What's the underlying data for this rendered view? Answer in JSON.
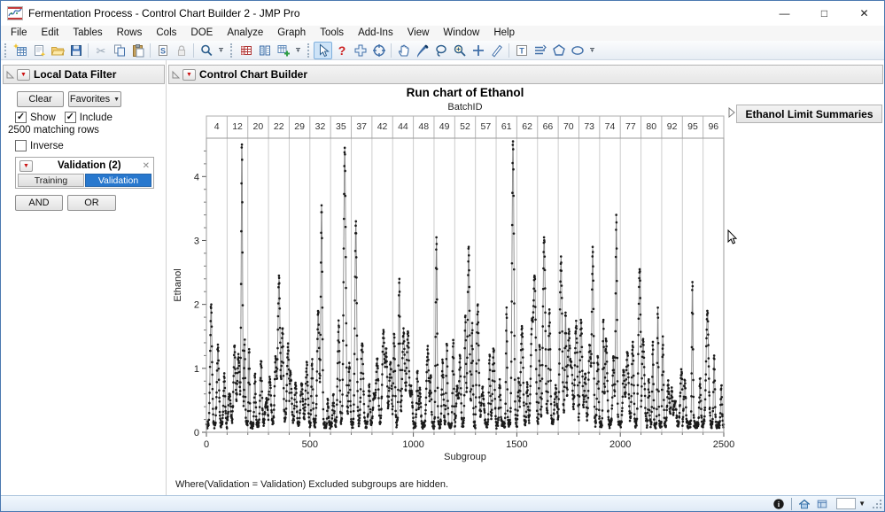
{
  "window": {
    "title": "Fermentation Process - Control Chart Builder 2 - JMP Pro",
    "controls": {
      "minimize": "—",
      "maximize": "□",
      "close": "✕"
    }
  },
  "menu": {
    "items": [
      "File",
      "Edit",
      "Tables",
      "Rows",
      "Cols",
      "DOE",
      "Analyze",
      "Graph",
      "Tools",
      "Add-Ins",
      "View",
      "Window",
      "Help"
    ]
  },
  "toolbar": {
    "selected_tool": "arrow-tool",
    "groups": [
      {
        "icons": [
          "new-data-table",
          "new-window",
          "open-file",
          "save",
          "sep",
          "cut",
          "copy",
          "paste",
          "sep",
          "journal",
          "lock",
          "sep",
          "search"
        ],
        "overflow": true
      },
      {
        "icons": [
          "data-table",
          "columns-viewer",
          "table-add"
        ],
        "overflow": true
      },
      {
        "icons": [
          "arrow-tool",
          "help-tool",
          "move-tool",
          "target-tool",
          "sep",
          "grabber-tool",
          "brush-tool",
          "lasso-tool",
          "magnifier-tool",
          "crosshair-tool",
          "eraser-tool",
          "sep",
          "annotate-tool",
          "line-tool",
          "polygon-tool",
          "oval-tool"
        ],
        "overflow": true
      }
    ]
  },
  "ui": {
    "red_triangle": "▼",
    "caret_down": "▼",
    "close_glyph": "✕"
  },
  "data_filter": {
    "title": "Local Data Filter",
    "clear_label": "Clear",
    "favorites_label": "Favorites",
    "show_label": "Show",
    "include_label": "Include",
    "show_check": "✓",
    "include_check": "✓",
    "inverse_check": "",
    "matching_rows": "2500 matching rows",
    "inverse_label": "Inverse",
    "filter": {
      "title": "Validation (2)",
      "options": [
        {
          "label": "Training",
          "selected": false
        },
        {
          "label": "Validation",
          "selected": true
        }
      ]
    },
    "and_label": "AND",
    "or_label": "OR"
  },
  "report": {
    "title": "Control Chart Builder",
    "limit_summaries_title": "Ethanol Limit Summaries",
    "footnote": "Where(Validation = Validation) Excluded subgroups are hidden."
  },
  "chart_data": {
    "type": "line",
    "title": "Run chart of Ethanol",
    "top_axis_label": "BatchID",
    "xlabel": "Subgroup",
    "ylabel": "Ethanol",
    "xlim": [
      0,
      2500
    ],
    "ylim": [
      0,
      4.6
    ],
    "x_major_ticks": [
      0,
      500,
      1000,
      1500,
      2000,
      2500
    ],
    "x_minor_step": 100,
    "y_major_ticks": [
      0,
      1,
      2,
      3,
      4
    ],
    "y_minor_step": 0.2,
    "points_per_batch": 100,
    "marker_color": "#1a1a1a",
    "line_color": "#878787",
    "boundary_line_color": "#cccccc",
    "batches": [
      {
        "id": "4",
        "peak": 2.0
      },
      {
        "id": "12",
        "peak": 4.5
      },
      {
        "id": "20",
        "peak": 1.3
      },
      {
        "id": "22",
        "peak": 2.45
      },
      {
        "id": "29",
        "peak": 1.1
      },
      {
        "id": "32",
        "peak": 3.55
      },
      {
        "id": "35",
        "peak": 4.45
      },
      {
        "id": "37",
        "peak": 3.3
      },
      {
        "id": "42",
        "peak": 1.6
      },
      {
        "id": "44",
        "peak": 2.4
      },
      {
        "id": "48",
        "peak": 1.35
      },
      {
        "id": "49",
        "peak": 3.05
      },
      {
        "id": "52",
        "peak": 2.9
      },
      {
        "id": "57",
        "peak": 2.0
      },
      {
        "id": "61",
        "peak": 4.55
      },
      {
        "id": "62",
        "peak": 2.45
      },
      {
        "id": "66",
        "peak": 3.05
      },
      {
        "id": "70",
        "peak": 2.75
      },
      {
        "id": "73",
        "peak": 2.9
      },
      {
        "id": "74",
        "peak": 3.4
      },
      {
        "id": "77",
        "peak": 2.55
      },
      {
        "id": "80",
        "peak": 1.95
      },
      {
        "id": "92",
        "peak": 1.5
      },
      {
        "id": "95",
        "peak": 2.35
      },
      {
        "id": "96",
        "peak": 1.9
      }
    ]
  },
  "status_bar": {
    "icons": [
      "info-icon",
      "home-icon",
      "window-list-icon",
      "window-selector-box",
      "window-selector-caret",
      "resize-grip"
    ]
  }
}
